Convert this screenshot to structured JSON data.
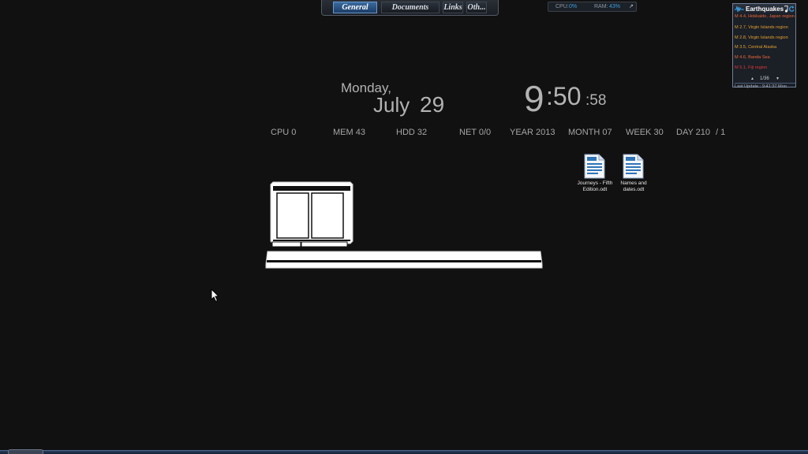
{
  "launcher": {
    "tabs": [
      {
        "label": "General",
        "active": true
      },
      {
        "label": "Documents",
        "active": false
      },
      {
        "label": "Links",
        "active": false
      },
      {
        "label": "Oth...",
        "active": false
      }
    ]
  },
  "sysmeter": {
    "cpu_label": "CPU:",
    "cpu_value": "0%",
    "ram_label": "RAM:",
    "ram_value": "43%",
    "link_glyph": "↗"
  },
  "earthquakes": {
    "title": "Earthquakes",
    "items": [
      {
        "text": "M 4.4, Hokkaido, Japan region",
        "color": "#e8683a"
      },
      {
        "text": "M 2.7, Virgin Islands region",
        "color": "#e0a030"
      },
      {
        "text": "M 2.8, Virgin Islands region",
        "color": "#e0a030"
      },
      {
        "text": "M 3.5, Central Alaska",
        "color": "#e0a030"
      },
      {
        "text": "M 4.6, Banda Sea",
        "color": "#e8683a"
      },
      {
        "text": "M 5.1, Fiji region",
        "color": "#d83a3a"
      }
    ],
    "page": "1/36",
    "last_update": "Last Update : 9:41:37 Mon"
  },
  "clock": {
    "weekday": "Monday,",
    "month": "July",
    "day": "29",
    "hour": "9",
    "minute": ":50",
    "second": ":58"
  },
  "stats": [
    {
      "label": "CPU 0"
    },
    {
      "label": "MEM 43"
    },
    {
      "label": "HDD 32"
    },
    {
      "label": "NET 0/0"
    },
    {
      "label": "YEAR 2013"
    },
    {
      "label": "MONTH 07"
    },
    {
      "label": "WEEK 30"
    },
    {
      "label": "DAY 210"
    },
    {
      "label": "/ 1"
    }
  ],
  "desktop_icons": [
    {
      "name": "Journeys - Fifth Edition.odt"
    },
    {
      "name": "Names and dates.odt"
    }
  ],
  "colors": {
    "background": "#111111",
    "accent": "#3c9fe0",
    "doc_icon_blue": "#2f74b8"
  }
}
